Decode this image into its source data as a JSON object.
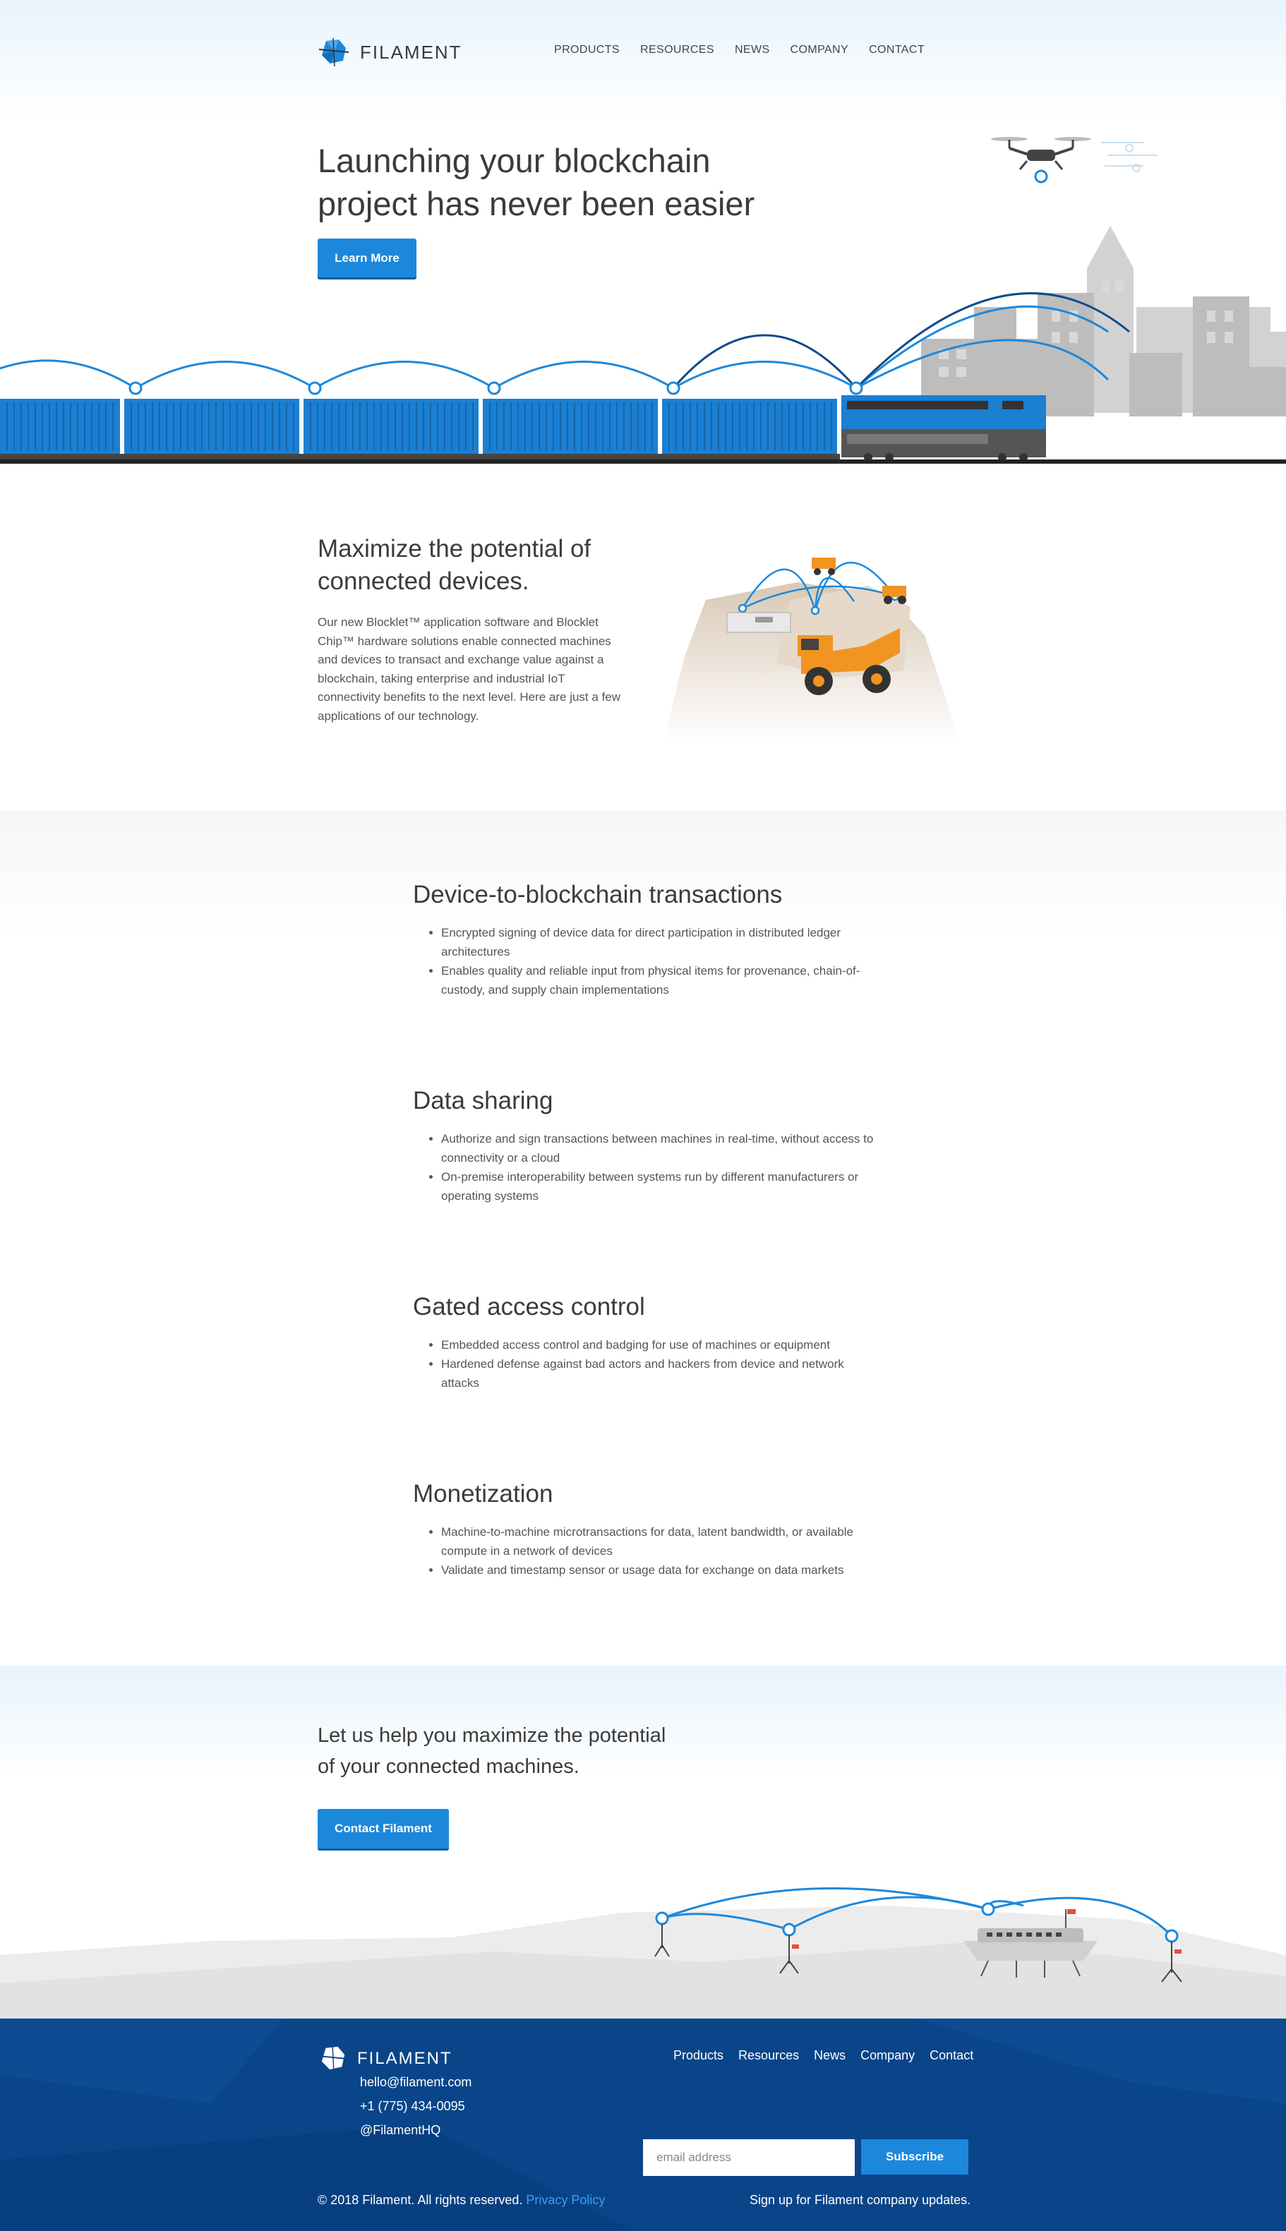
{
  "brand": {
    "name": "FILAMENT",
    "blue": "#1b88dc",
    "footer_blue": "#0a4589"
  },
  "nav": {
    "items": [
      "PRODUCTS",
      "RESOURCES",
      "NEWS",
      "COMPANY",
      "CONTACT"
    ]
  },
  "hero": {
    "title_line1": "Launching your blockchain",
    "title_line2": "project has never been easier",
    "button": "Learn More"
  },
  "intro": {
    "title_line1": "Maximize the potential of",
    "title_line2": "connected devices.",
    "body": "Our new Blocklet™ application software and Blocklet Chip™ hardware solutions enable connected machines and devices to transact and exchange value against a blockchain, taking enterprise and industrial IoT connectivity benefits to the next level. Here are just a few applications of our technology."
  },
  "features": [
    {
      "title": "Device-to-blockchain transactions",
      "bullets": [
        "Encrypted signing of device data for direct participation in distributed ledger architectures",
        "Enables quality and reliable input from physical items for provenance, chain-of- custody, and supply chain implementations"
      ]
    },
    {
      "title": "Data sharing",
      "bullets": [
        "Authorize and sign transactions between machines in real-time, without access to connectivity or a cloud",
        "On-premise interoperability between systems run by different manufacturers or operating systems"
      ]
    },
    {
      "title": "Gated access control",
      "bullets": [
        "Embedded access control and badging for use of machines or equipment",
        "Hardened defense against bad actors and hackers from device and network attacks"
      ]
    },
    {
      "title": "Monetization",
      "bullets": [
        "Machine-to-machine microtransactions for data, latent bandwidth, or available compute in a network of devices",
        "Validate and timestamp sensor or usage data for exchange on data markets"
      ]
    }
  ],
  "cta": {
    "title_line1": "Let us help you maximize the potential",
    "title_line2": "of your connected machines.",
    "button": "Contact Filament"
  },
  "footer": {
    "logo_text": "FILAMENT",
    "email": "hello@filament.com",
    "phone": "+1 (775) 434-0095",
    "twitter": "@FilamentHQ",
    "links": [
      "Products",
      "Resources",
      "News",
      "Company",
      "Contact"
    ],
    "email_placeholder": "email address",
    "subscribe": "Subscribe",
    "copyright": "© 2018 Filament. All rights reserved.",
    "privacy": "Privacy Policy",
    "signup_note": "Sign up for Filament company updates."
  }
}
